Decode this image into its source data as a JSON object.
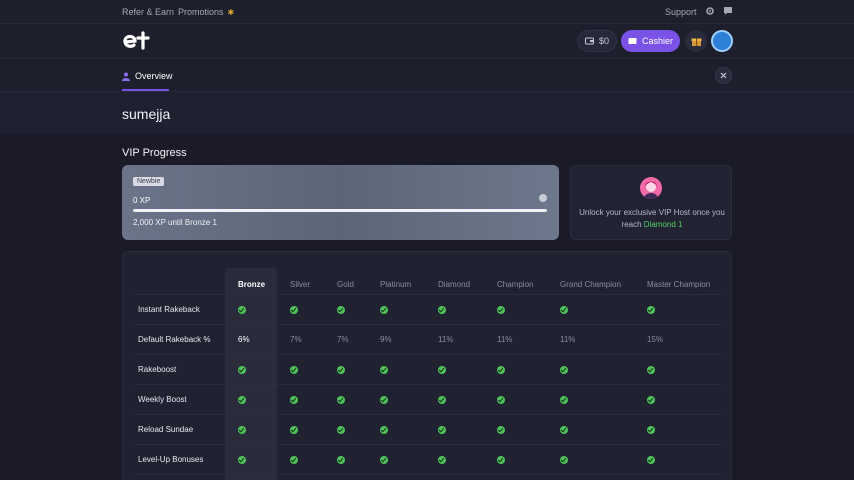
{
  "topbar": {
    "refer": "Refer & Earn",
    "promotions": "Promotions",
    "support": "Support"
  },
  "header": {
    "balance": "$0",
    "cashier": "Cashier"
  },
  "tabs": {
    "overview": "Overview"
  },
  "user": {
    "name": "sumejja"
  },
  "vip": {
    "title": "VIP Progress",
    "badge": "Newbie",
    "xp": "0 XP",
    "until": "2,000 XP until Bronze 1",
    "progress_fraction": 0,
    "host_text": "Unlock your exclusive VIP Host once you reach",
    "host_tier": "Diamond 1"
  },
  "table": {
    "tiers": [
      "Bronze",
      "Silver",
      "Gold",
      "Platinum",
      "Diamond",
      "Champion",
      "Grand Champion",
      "Master Champion"
    ],
    "rows": [
      {
        "label": "Instant Rakeback",
        "type": "check"
      },
      {
        "label": "Default Rakeback %",
        "type": "value",
        "values": [
          "6%",
          "7%",
          "7%",
          "9%",
          "11%",
          "11%",
          "11%",
          "15%"
        ]
      },
      {
        "label": "Rakeboost",
        "type": "check"
      },
      {
        "label": "Weekly Boost",
        "type": "check"
      },
      {
        "label": "Reload Sundae",
        "type": "check"
      },
      {
        "label": "Level-Up Bonuses",
        "type": "check"
      }
    ]
  },
  "colors": {
    "accent": "#7a52e6",
    "check": "#4fc25b",
    "diamond": "#4fd469"
  }
}
